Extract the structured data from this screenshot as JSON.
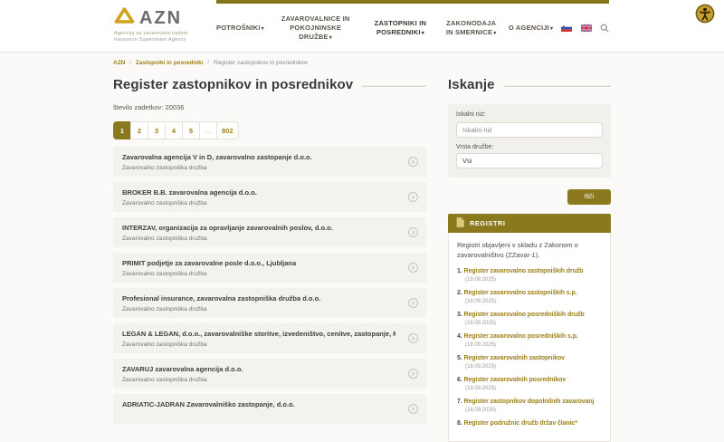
{
  "colors": {
    "accent_gold": "#8a791d",
    "link_gold": "#9d811a",
    "card_bg": "#f3f2ef"
  },
  "icons": {
    "caret": "▾",
    "chevron_right": "›",
    "search": "magnifier-icon",
    "accessibility": "accessibility-person-icon",
    "flag_si": "slovenia-flag-icon",
    "flag_en": "uk-flag-icon",
    "registri_doc": "document-icon",
    "logo_mark": "gold-triangle-logo"
  },
  "header": {
    "logo": {
      "acronym": "AZN",
      "tagline1": "Agencija za zavarovalni nadzor",
      "tagline2": "Insurance Supervision Agency"
    },
    "nav": [
      {
        "label": "POTROŠNIKI"
      },
      {
        "label": "ZAVAROVALNICE IN POKOJNINSKE DRUŽBE"
      },
      {
        "label": "ZASTOPNIKI IN POSREDNIKI"
      },
      {
        "label": "ZAKONODAJA IN SMERNICE"
      },
      {
        "label": "O AGENCIJI"
      }
    ]
  },
  "breadcrumb": {
    "separator": "/",
    "items": [
      "AZN",
      "Zastopniki in posredniki",
      "Register zastopnikov in posrednikov"
    ]
  },
  "main": {
    "title": "Register zastopnikov in posrednikov",
    "results_count": "število zadetkov: 20036",
    "pagination": [
      "1",
      "2",
      "3",
      "4",
      "5",
      "...",
      "802"
    ],
    "items": [
      {
        "title": "Zavarovalna agencija V in D, zavarovalno zastopanje d.o.o.",
        "subtitle": "Zavarovalno zastopniška družba"
      },
      {
        "title": "BROKER B.B. zavarovalna agencija d.o.o.",
        "subtitle": "Zavarovalno zastopniška družba"
      },
      {
        "title": "INTERZAV, organizacija za opravljanje zavarovalnih poslov, d.o.o.",
        "subtitle": "Zavarovalno zastopniška družba"
      },
      {
        "title": "PRIMIT podjetje za zavarovalne posle d.o.o., Ljubljana",
        "subtitle": "Zavarovalno zastopniška družba"
      },
      {
        "title": "Profesional insurance, zavarovalna zastopniška družba d.o.o.",
        "subtitle": "Zavarovalno zastopniška družba"
      },
      {
        "title": "LEGAN & LEGAN, d.o.o., zavarovalniške storitve, izvedeništvo, cenitve, zastopanje, Medvode",
        "subtitle": "Zavarovalno zastopniška družba"
      },
      {
        "title": "ZAVARUJ zavarovalna agencija d.o.o.",
        "subtitle": "Zavarovalno zastopniška družba"
      },
      {
        "title": "ADRIATIC-JADRAN Zavarovalniško zastopanje, d.o.o.",
        "subtitle": ""
      }
    ]
  },
  "sidebar": {
    "search": {
      "title": "Iskanje",
      "query_label": "Iskalni niz:",
      "query_placeholder": "Iskalni niz",
      "type_label": "Vrsta družbe:",
      "type_value": "Vsi",
      "submit_label": "Išči"
    },
    "registri": {
      "title": "REGISTRI",
      "intro": "Registri objavljeni v skladu z Zakonom o zavarovalništvu (ZZavar-1).",
      "links": [
        {
          "num": "1.",
          "label": "Register zavarovalno zastopniških družb",
          "date": "(18.09.2025)"
        },
        {
          "num": "2.",
          "label": "Register zavarovalno zastopniških s.p.",
          "date": "(18.09.2025)"
        },
        {
          "num": "3.",
          "label": "Register zavarovalno posredniških družb",
          "date": "(18.09.2025)"
        },
        {
          "num": "4.",
          "label": "Register zavarovalno posredniških s.p.",
          "date": "(18.09.2025)"
        },
        {
          "num": "5.",
          "label": "Register zavarovalnih zastopnikov",
          "date": "(18.09.2025)"
        },
        {
          "num": "6.",
          "label": "Register zavarovalnih posrednikov",
          "date": "(18.09.2025)"
        },
        {
          "num": "7.",
          "label": "Register zastopnikov dopolnilnih zavarovanj",
          "date": "(18.09.2025)"
        },
        {
          "num": "8.",
          "label": "Register podružnic družb držav članic*",
          "date": ""
        }
      ]
    }
  }
}
